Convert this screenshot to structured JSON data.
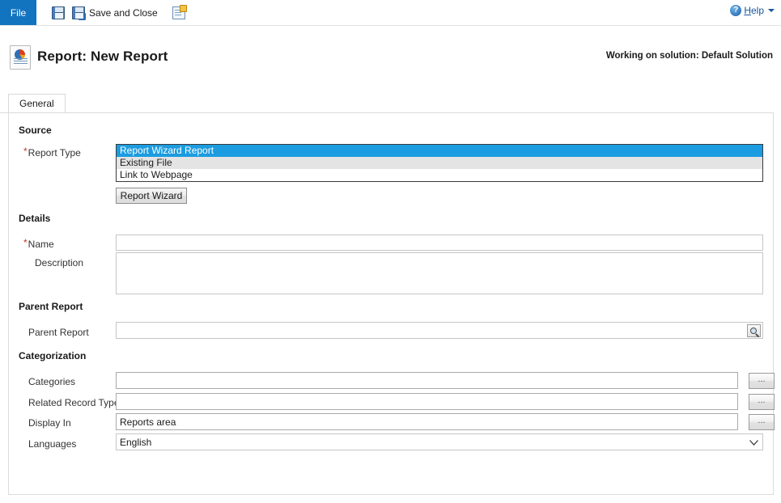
{
  "ribbon": {
    "file_tab": "File",
    "commands": [
      {
        "name": "save",
        "label": "",
        "icon": "save-icon"
      },
      {
        "name": "save-and-close",
        "label": "Save and Close",
        "icon": "save-and-close-icon"
      },
      {
        "name": "new",
        "label": "",
        "icon": "new-report-icon"
      }
    ],
    "help": {
      "label_prefix": "",
      "label_underlined": "H",
      "label_rest": "elp",
      "icon": "help-icon"
    }
  },
  "header": {
    "record_icon": "report-icon",
    "title": "Report: New Report",
    "solution_note": "Working on solution: Default Solution"
  },
  "tabs": [
    {
      "label": "General",
      "active": true
    }
  ],
  "sections": {
    "source": {
      "title": "Source",
      "report_type": {
        "label": "Report Type",
        "required": true,
        "options": [
          {
            "text": "Report Wizard Report",
            "selected": true
          },
          {
            "text": "Existing File",
            "selected": false
          },
          {
            "text": "Link to Webpage",
            "selected": false
          }
        ]
      },
      "report_wizard_button": "Report Wizard"
    },
    "details": {
      "title": "Details",
      "name": {
        "label": "Name",
        "required": true,
        "value": "",
        "placeholder": ""
      },
      "description": {
        "label": "Description",
        "required": false,
        "value": "",
        "placeholder": ""
      }
    },
    "parent_report": {
      "title": "Parent Report",
      "field": {
        "label": "Parent Report",
        "value": "",
        "placeholder": "",
        "lookup_icon": "lookup-icon"
      }
    },
    "categorization": {
      "title": "Categorization",
      "categories": {
        "label": "Categories",
        "value": "",
        "button": "..."
      },
      "related_record_types": {
        "label": "Related Record Types",
        "value": "",
        "button": "..."
      },
      "display_in": {
        "label": "Display In",
        "value": "Reports area",
        "button": "..."
      },
      "languages": {
        "label": "Languages",
        "value": "English",
        "options": [
          "English"
        ]
      }
    }
  },
  "colors": {
    "file_tab_blue": "#1273bf",
    "selection_blue": "#1b9ce0",
    "required_red": "#c0392b",
    "help_link_blue": "#16559a"
  }
}
